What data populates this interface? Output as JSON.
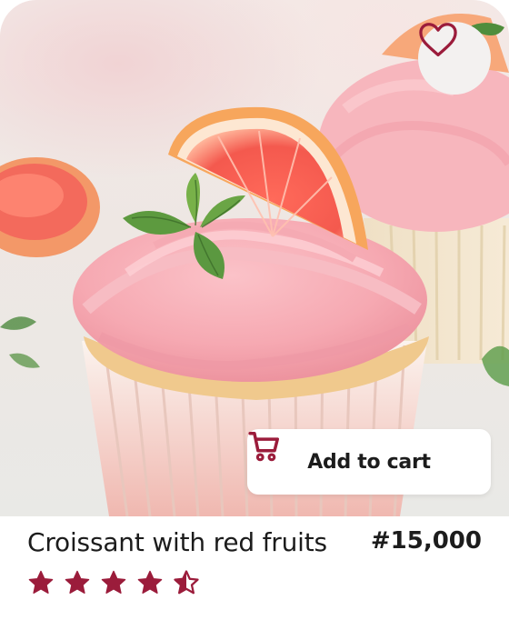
{
  "product": {
    "name": "Croissant with red fruits",
    "price": "#15,000",
    "rating": 4.5,
    "rating_max": 5
  },
  "actions": {
    "add_to_cart_label": "Add to cart",
    "cart_icon": "shopping-cart-icon",
    "favorite_icon": "heart-icon"
  },
  "colors": {
    "accent": "#9b1c3b",
    "frosting": "#f4a6b0",
    "card_background": "#ffffff"
  }
}
